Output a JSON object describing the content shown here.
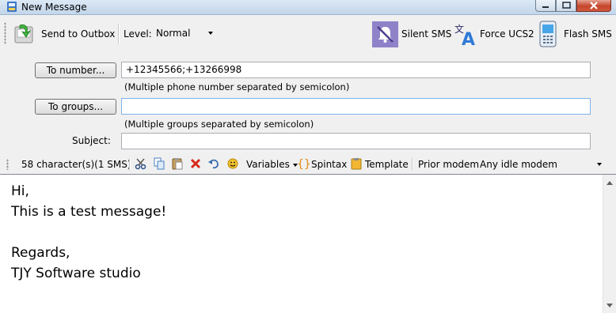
{
  "window": {
    "title": "New Message"
  },
  "toolbar": {
    "send_label": "Send to Outbox",
    "level_label": "Level:",
    "level_value": "Normal",
    "silent_sms_label": "Silent SMS",
    "force_ucs2_label": "Force UCS2",
    "flash_sms_label": "Flash SMS"
  },
  "form": {
    "to_number_button": "To number...",
    "to_number_value": "+12345566;+13266998",
    "to_number_hint": "(Multiple phone number separated by semicolon)",
    "to_groups_button": "To groups...",
    "to_groups_value": "",
    "to_groups_hint": "(Multiple groups separated by semicolon)",
    "subject_label": "Subject:",
    "subject_value": ""
  },
  "editor_toolbar": {
    "char_count": "58 character(s)(1 SMS)",
    "icons": [
      "cut-icon",
      "copy-icon",
      "paste-icon",
      "delete-icon",
      "undo-icon",
      "emoticon-icon"
    ],
    "variables_label": "Variables",
    "spintax_label": "Spintax",
    "template_label": "Template",
    "prior_modem_label": "Prior modem",
    "prior_modem_value": "Any idle modem"
  },
  "editor": {
    "body": "Hi,\nThis is a test message!\n\nRegards,\nTJY Software studio"
  },
  "colors": {
    "titlebar": "#c3d6ea",
    "close_button": "#c5452c",
    "silent_icon_bg": "#8f82c8",
    "field_focus_border": "#7eb4ea"
  }
}
